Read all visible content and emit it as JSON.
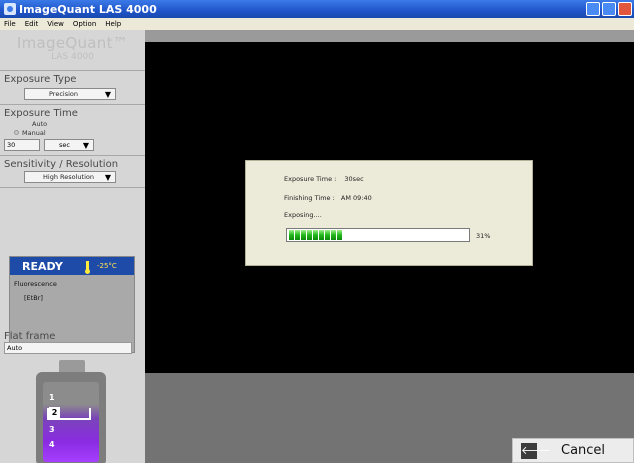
{
  "window": {
    "title": "ImageQuant LAS 4000"
  },
  "menu": [
    "File",
    "Edit",
    "View",
    "Option",
    "Help"
  ],
  "logo": {
    "line1": "ImageQuant™",
    "line2": "LAS 4000"
  },
  "exposure_type": {
    "title": "Exposure Type",
    "value": "Precision"
  },
  "exposure_time": {
    "title": "Exposure Time",
    "options": [
      "Auto",
      "Manual"
    ],
    "value": "30",
    "unit": "sec"
  },
  "sensitivity": {
    "title": "Sensitivity / Resolution",
    "value": "High Resolution"
  },
  "status": {
    "state": "READY",
    "temperature": "-25°C",
    "mode": "Fluorescence",
    "dye": "[EtBr]"
  },
  "flat_frame": {
    "title": "Flat frame",
    "value": "Auto"
  },
  "tray": {
    "positions": [
      "1",
      "2",
      "3",
      "4"
    ],
    "selected": "2"
  },
  "exposure_dialog": {
    "exposure_time_label": "Exposure Time :",
    "exposure_time_value": "30sec",
    "finishing_time_label": "Finishing Time :",
    "finishing_time_value": "AM 09:40",
    "status_text": "Exposing....",
    "progress_percent": 31,
    "progress_text": "31%"
  },
  "cancel_button": {
    "label": "Cancel"
  },
  "colors": {
    "titlebar": "#1f55c9",
    "ready_bar": "#1f4ba8",
    "progress_green": "#22b81b",
    "tray_purple": "#8a2be2"
  },
  "icons": {
    "app": "app-icon",
    "cancel": "back-arrow-icon",
    "thermometer": "thermometer-icon"
  }
}
